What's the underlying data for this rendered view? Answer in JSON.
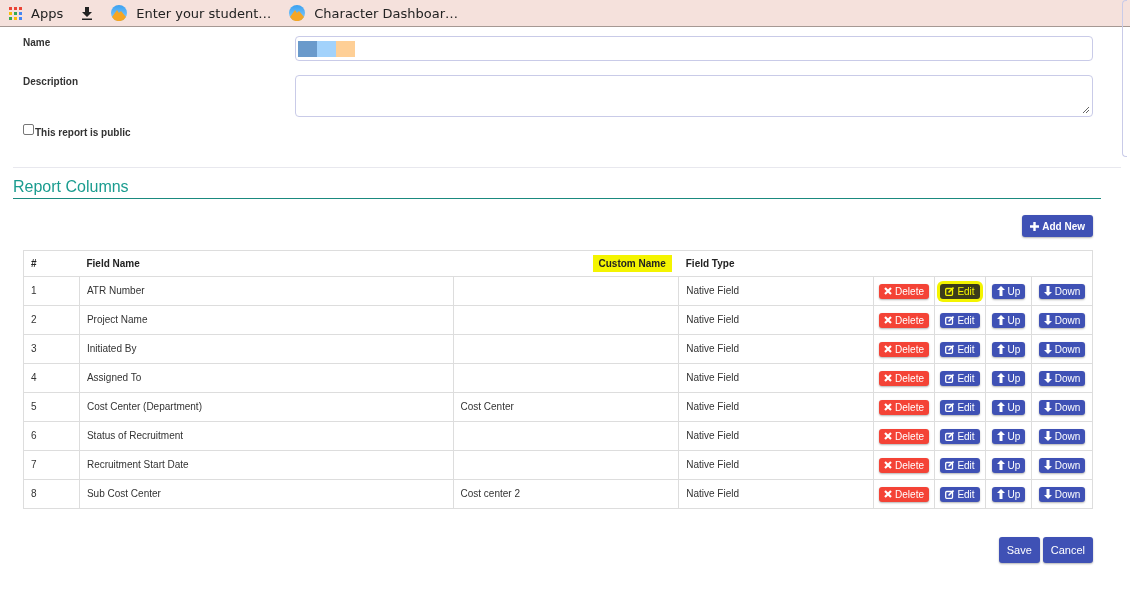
{
  "bookmarks_bar": {
    "items": [
      {
        "kind": "apps",
        "label": "Apps"
      },
      {
        "kind": "download"
      },
      {
        "kind": "page",
        "label": "Enter your student…"
      },
      {
        "kind": "page",
        "label": "Character Dashboar…"
      }
    ]
  },
  "form": {
    "name": {
      "label": "Name"
    },
    "description": {
      "label": "Description"
    },
    "public": {
      "label": "This report is public",
      "checked": false
    }
  },
  "section_title": "Report Columns",
  "add_button": "Add New",
  "table": {
    "columns": [
      {
        "label": "#",
        "highlighted": false
      },
      {
        "label": "Field Name",
        "highlighted": false
      },
      {
        "label": "Custom Name",
        "highlighted": true
      },
      {
        "label": "Field Type",
        "highlighted": false
      }
    ],
    "rows": [
      {
        "number": "1",
        "field_name": "ATR Number",
        "custom_name": "",
        "field_type": "Native Field",
        "actions": [
          {
            "kind": "delete",
            "label": "Delete",
            "highlighted": false
          },
          {
            "kind": "edit",
            "label": "Edit",
            "highlighted": true
          },
          {
            "kind": "up",
            "label": "Up",
            "highlighted": false
          },
          {
            "kind": "down",
            "label": "Down",
            "highlighted": false
          }
        ]
      },
      {
        "number": "2",
        "field_name": "Project Name",
        "custom_name": "",
        "field_type": "Native Field",
        "actions": [
          {
            "kind": "delete",
            "label": "Delete",
            "highlighted": false
          },
          {
            "kind": "edit",
            "label": "Edit",
            "highlighted": false
          },
          {
            "kind": "up",
            "label": "Up",
            "highlighted": false
          },
          {
            "kind": "down",
            "label": "Down",
            "highlighted": false
          }
        ]
      },
      {
        "number": "3",
        "field_name": "Initiated By",
        "custom_name": "",
        "field_type": "Native Field",
        "actions": [
          {
            "kind": "delete",
            "label": "Delete",
            "highlighted": false
          },
          {
            "kind": "edit",
            "label": "Edit",
            "highlighted": false
          },
          {
            "kind": "up",
            "label": "Up",
            "highlighted": false
          },
          {
            "kind": "down",
            "label": "Down",
            "highlighted": false
          }
        ]
      },
      {
        "number": "4",
        "field_name": "Assigned To",
        "custom_name": "",
        "field_type": "Native Field",
        "actions": [
          {
            "kind": "delete",
            "label": "Delete",
            "highlighted": false
          },
          {
            "kind": "edit",
            "label": "Edit",
            "highlighted": false
          },
          {
            "kind": "up",
            "label": "Up",
            "highlighted": false
          },
          {
            "kind": "down",
            "label": "Down",
            "highlighted": false
          }
        ]
      },
      {
        "number": "5",
        "field_name": "Cost Center (Department)",
        "custom_name": "Cost Center",
        "field_type": "Native Field",
        "actions": [
          {
            "kind": "delete",
            "label": "Delete",
            "highlighted": false
          },
          {
            "kind": "edit",
            "label": "Edit",
            "highlighted": false
          },
          {
            "kind": "up",
            "label": "Up",
            "highlighted": false
          },
          {
            "kind": "down",
            "label": "Down",
            "highlighted": false
          }
        ]
      },
      {
        "number": "6",
        "field_name": "Status of Recruitment",
        "custom_name": "",
        "field_type": "Native Field",
        "actions": [
          {
            "kind": "delete",
            "label": "Delete",
            "highlighted": false
          },
          {
            "kind": "edit",
            "label": "Edit",
            "highlighted": false
          },
          {
            "kind": "up",
            "label": "Up",
            "highlighted": false
          },
          {
            "kind": "down",
            "label": "Down",
            "highlighted": false
          }
        ]
      },
      {
        "number": "7",
        "field_name": "Recruitment Start Date",
        "custom_name": "",
        "field_type": "Native Field",
        "actions": [
          {
            "kind": "delete",
            "label": "Delete",
            "highlighted": false
          },
          {
            "kind": "edit",
            "label": "Edit",
            "highlighted": false
          },
          {
            "kind": "up",
            "label": "Up",
            "highlighted": false
          },
          {
            "kind": "down",
            "label": "Down",
            "highlighted": false
          }
        ]
      },
      {
        "number": "8",
        "field_name": "Sub Cost Center",
        "custom_name": "Cost center 2",
        "field_type": "Native Field",
        "actions": [
          {
            "kind": "delete",
            "label": "Delete",
            "highlighted": false
          },
          {
            "kind": "edit",
            "label": "Edit",
            "highlighted": false
          },
          {
            "kind": "up",
            "label": "Up",
            "highlighted": false
          },
          {
            "kind": "down",
            "label": "Down",
            "highlighted": false
          }
        ]
      }
    ]
  },
  "footer_buttons": [
    "Save",
    "Cancel"
  ]
}
